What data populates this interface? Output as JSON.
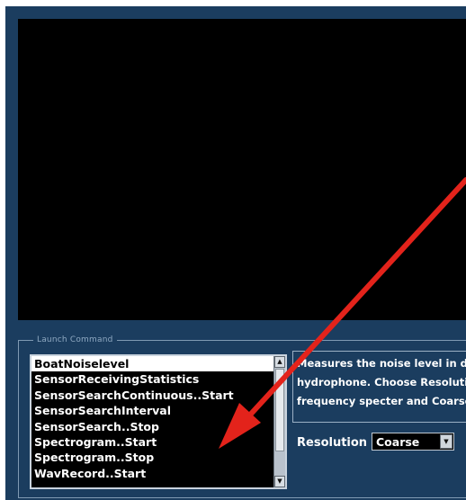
{
  "launch_group": {
    "legend": "Launch Command",
    "commands": [
      "BoatNoiselevel",
      "SensorReceivingStatistics",
      "SensorSearchContinuous..Start",
      "SensorSearchInterval",
      "SensorSearch..Stop",
      "Spectrogram..Start",
      "Spectrogram..Stop",
      "WavRecord..Start"
    ],
    "selected_index": 0
  },
  "description": {
    "lines": [
      "Measures the noise level in dB",
      "hydrophone. Choose Resolution",
      "frequency specter and Coarse"
    ]
  },
  "resolution": {
    "label": "Resolution",
    "value": "Coarse"
  },
  "colors": {
    "panel": "#1b3d5f",
    "display": "#000000",
    "annotation_arrow": "#e3231b"
  },
  "icons": {
    "scroll_up": "triangle-up",
    "scroll_down": "triangle-down",
    "dropdown": "triangle-down",
    "annotation": "red-arrow"
  }
}
